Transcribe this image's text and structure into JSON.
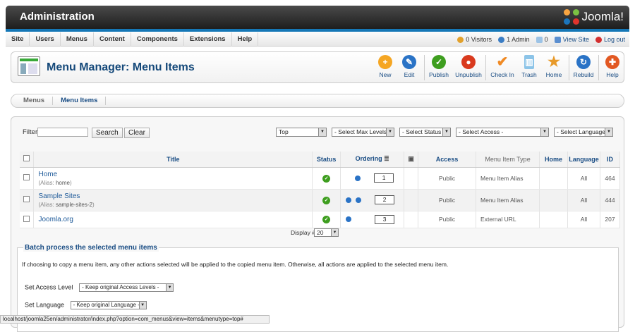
{
  "header": {
    "title": "Administration",
    "logo_text": "Joomla!"
  },
  "menubar": {
    "items": [
      "Site",
      "Users",
      "Menus",
      "Content",
      "Components",
      "Extensions",
      "Help"
    ],
    "status": {
      "visitors": "0 Visitors",
      "admin": "1 Admin",
      "messages": "0",
      "view_site": "View Site",
      "logout": "Log out"
    }
  },
  "page": {
    "title": "Menu Manager: Menu Items"
  },
  "toolbar": {
    "new": "New",
    "edit": "Edit",
    "publish": "Publish",
    "unpublish": "Unpublish",
    "checkin": "Check In",
    "trash": "Trash",
    "home": "Home",
    "rebuild": "Rebuild",
    "help": "Help"
  },
  "colors": {
    "accent": "#1577b6",
    "new": "#f5a623",
    "edit": "#2a73c6",
    "publish": "#3e9e1f",
    "unpublish": "#d93a1e",
    "checkin": "#f08a24",
    "home": "#e89a2a",
    "rebuild": "#2a73c6",
    "help": "#e25822"
  },
  "icons": {
    "new": "plus-icon",
    "edit": "pencil-icon",
    "publish": "check-icon",
    "unpublish": "stop-icon",
    "checkin": "checkmark-icon",
    "trash": "trash-icon",
    "home": "star-icon",
    "rebuild": "refresh-icon",
    "help": "lifebuoy-icon"
  },
  "subnav": {
    "menus": "Menus",
    "menu_items": "Menu Items"
  },
  "filter": {
    "label": "Filter:",
    "search": "Search",
    "clear": "Clear",
    "menutype": "Top",
    "max_levels": "- Select Max Levels -",
    "status": "- Select Status -",
    "access": "- Select Access -",
    "language": "- Select Language -"
  },
  "table": {
    "headers": {
      "title": "Title",
      "status": "Status",
      "ordering": "Ordering",
      "access": "Access",
      "type": "Menu Item Type",
      "home": "Home",
      "language": "Language",
      "id": "ID"
    },
    "rows": [
      {
        "title": "Home",
        "alias_label": "(Alias: ",
        "alias": "home",
        "alias_end": ")",
        "order": "1",
        "access": "Public",
        "type": "Menu Item Alias",
        "language": "All",
        "id": "464"
      },
      {
        "title": "Sample Sites",
        "alias_label": "(Alias: ",
        "alias": "sample-sites-2",
        "alias_end": ")",
        "order": "2",
        "access": "Public",
        "type": "Menu Item Alias",
        "language": "All",
        "id": "444"
      },
      {
        "title": "Joomla.org",
        "order": "3",
        "access": "Public",
        "type": "External URL",
        "language": "All",
        "id": "207"
      }
    ]
  },
  "display": {
    "label": "Display #",
    "value": "20"
  },
  "batch": {
    "legend": "Batch process the selected menu items",
    "desc": "If choosing to copy a menu item, any other actions selected will be applied to the copied menu item. Otherwise, all actions are applied to the selected menu item.",
    "access_label": "Set Access Level",
    "access_value": "- Keep original Access Levels -",
    "language_label": "Set Language",
    "language_value": "- Keep original Language -"
  },
  "statusbar": {
    "url": "localhost/joomla25en/administrator/index.php?option=com_menus&view=items&menutype=top#"
  }
}
